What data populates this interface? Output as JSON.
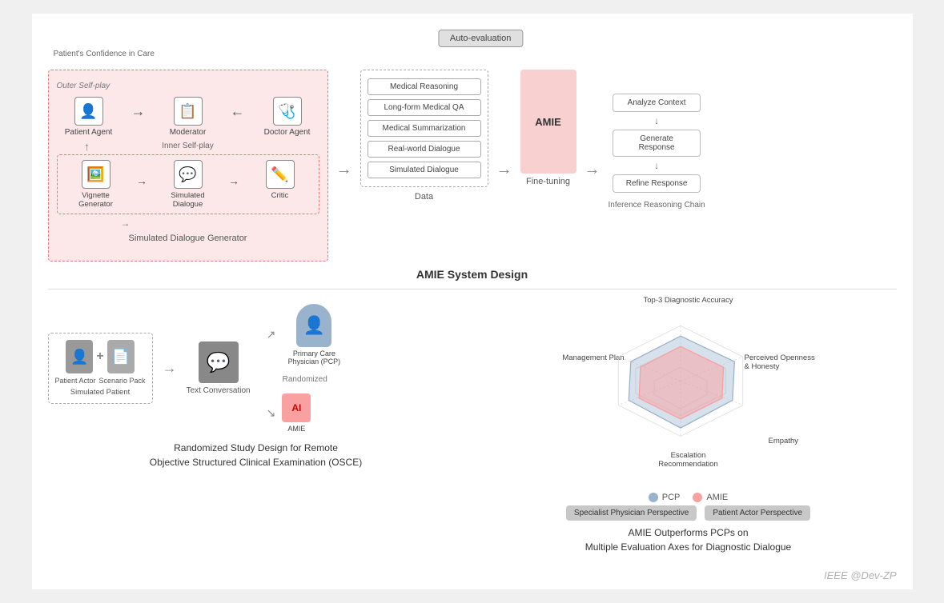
{
  "page": {
    "background": "#f0f0f0"
  },
  "top": {
    "auto_eval": "Auto-evaluation",
    "sdg_section_label": "Simulated Dialogue Generator",
    "patient_confidence": "Patient's Confidence in Care",
    "outer_self_play": "Outer Self-play",
    "inner_self_play": "Inner Self-play",
    "patient_agent": "Patient Agent",
    "moderator": "Moderator",
    "doctor_agent": "Doctor Agent",
    "vignette_generator": "Vignette Generator",
    "simulated_dialogue": "Simulated Dialogue",
    "critic": "Critic",
    "data_items": [
      "Medical Reasoning",
      "Long-form Medical QA",
      "Medical Summarization",
      "Real-world Dialogue",
      "Simulated Dialogue"
    ],
    "data_label": "Data",
    "amie_label": "AMIE",
    "fine_tuning_label": "Fine-tuning",
    "analyze_context": "Analyze Context",
    "generate_response": "Generate Response",
    "refine_response": "Refine Response",
    "inference_label": "Inference Reasoning Chain",
    "system_title": "AMIE System Design"
  },
  "bottom_left": {
    "title_line1": "Randomized Study Design for Remote",
    "title_line2": "Objective Structured Clinical Examination (OSCE)",
    "patient_actor": "Patient Actor",
    "scenario_pack": "Scenario Pack",
    "simulated_patient": "Simulated Patient",
    "randomized": "Randomized",
    "text_conversation": "Text Conversation",
    "pcp_label": "Primary Care Physician (PCP)",
    "amie_label": "AMIE"
  },
  "bottom_right": {
    "title_line1": "AMIE Outperforms PCPs on",
    "title_line2": "Multiple Evaluation Axes for Diagnostic Dialogue",
    "axes": {
      "top": "Top-3 Diagnostic Accuracy",
      "top_right": "Perceived Openness & Honesty",
      "bottom_right": "Empathy",
      "bottom": "Escalation Recommendation",
      "bottom_left": "Management Plan"
    },
    "pill_left": "Specialist Physician Perspective",
    "pill_right": "Patient Actor Perspective",
    "legend_pcp": "PCP",
    "legend_amie": "AMIE"
  },
  "watermark": "IEEE @Dev-ZP"
}
